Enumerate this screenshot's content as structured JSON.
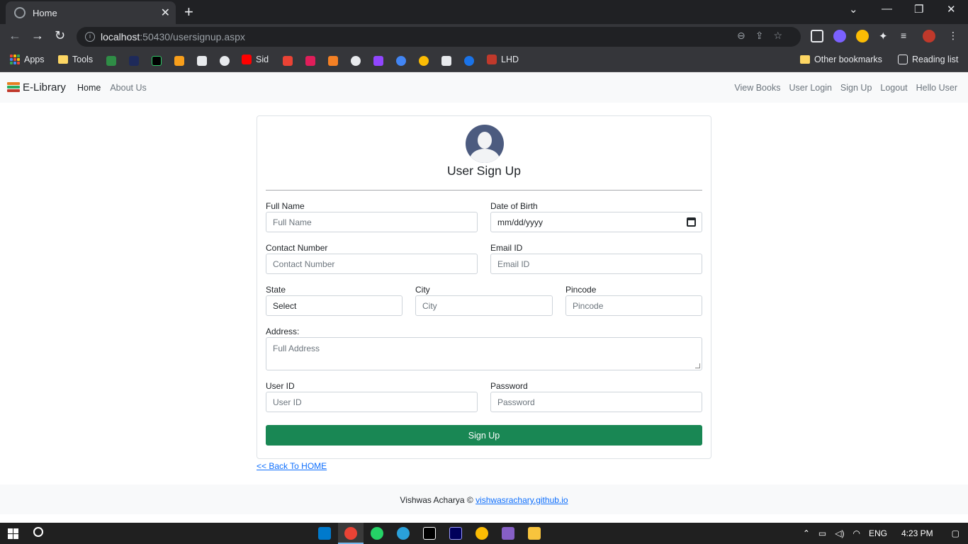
{
  "browser": {
    "tab_title": "Home",
    "tab_close": "✕",
    "new_tab": "+",
    "url_host": "localhost",
    "url_path": ":50430/usersignup.aspx",
    "bookmarks": [
      {
        "label": "Apps"
      },
      {
        "label": "Tools"
      },
      {
        "label": "Sid"
      },
      {
        "label": "LHD"
      }
    ],
    "other_bookmarks": "Other bookmarks",
    "reading_list": "Reading list"
  },
  "navbar": {
    "brand": "E-Library",
    "left_links": [
      "Home",
      "About Us"
    ],
    "right_links": [
      "View Books",
      "User Login",
      "Sign Up",
      "Logout",
      "Hello User"
    ]
  },
  "form": {
    "title": "User Sign Up",
    "full_name": {
      "label": "Full Name",
      "placeholder": "Full Name"
    },
    "dob": {
      "label": "Date of Birth",
      "value": "mm/dd/yyyy"
    },
    "contact": {
      "label": "Contact Number",
      "placeholder": "Contact Number"
    },
    "email": {
      "label": "Email ID",
      "placeholder": "Email ID"
    },
    "state": {
      "label": "State",
      "value": "Select"
    },
    "city": {
      "label": "City",
      "placeholder": "City"
    },
    "pincode": {
      "label": "Pincode",
      "placeholder": "Pincode"
    },
    "address": {
      "label": "Address:",
      "placeholder": "Full Address"
    },
    "user_id": {
      "label": "User ID",
      "placeholder": "User ID"
    },
    "password": {
      "label": "Password",
      "placeholder": "Password"
    },
    "submit": "Sign Up"
  },
  "back_link": "<< Back To HOME",
  "footer": {
    "text": "Vishwas Acharya © ",
    "link": "vishwasrachary.github.io"
  },
  "taskbar": {
    "lang": "ENG",
    "time": "4:23 PM"
  },
  "colors": {
    "accent": "#198754",
    "link": "#0d6efd",
    "chrome_dark": "#202124"
  }
}
